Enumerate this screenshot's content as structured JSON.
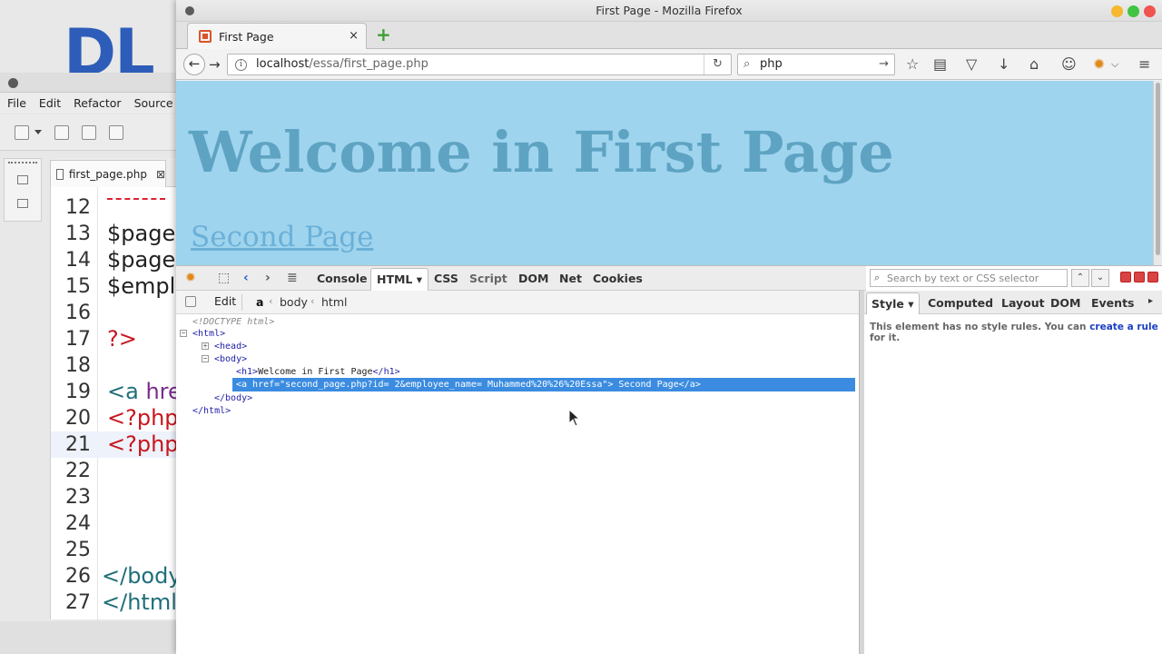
{
  "ide": {
    "logo_text": "DL",
    "menu": [
      "File",
      "Edit",
      "Refactor",
      "Source"
    ],
    "tab_label": "first_page.php",
    "tab_close": "⊠",
    "lines": [
      {
        "n": "12",
        "code": ""
      },
      {
        "n": "13",
        "code": "$page"
      },
      {
        "n": "14",
        "code": "$page"
      },
      {
        "n": "15",
        "code": "$empl"
      },
      {
        "n": "16",
        "code": ""
      },
      {
        "n": "17",
        "code": "?>"
      },
      {
        "n": "18",
        "code": ""
      },
      {
        "n": "19",
        "code_a": "<a",
        "code_b": " hre"
      },
      {
        "n": "20",
        "code": "<?php"
      },
      {
        "n": "21",
        "code": "<?php"
      },
      {
        "n": "22",
        "code": ""
      },
      {
        "n": "23",
        "code": ""
      },
      {
        "n": "24",
        "code": ""
      },
      {
        "n": "25",
        "code": ""
      },
      {
        "n": "26",
        "code": "</body"
      },
      {
        "n": "27",
        "code": "</html"
      }
    ]
  },
  "firefox": {
    "window_title": "First Page - Mozilla Firefox",
    "tab_title": "First Page",
    "tab_close": "×",
    "new_tab": "+",
    "url_host": "localhost",
    "url_path": "/essa/first_page.php",
    "search_value": "php",
    "icons": [
      "star-icon",
      "reading-list-icon",
      "pocket-icon",
      "download-icon",
      "home-icon",
      "chat-icon",
      "firebug-icon",
      "menu-icon"
    ],
    "colors": {
      "page_bg": "#9fd4ee",
      "heading": "#5ea3c2",
      "link": "#6bb0d7",
      "selection": "#3b8ce0"
    }
  },
  "page": {
    "heading": "Welcome in First Page",
    "link": "Second Page"
  },
  "firebug": {
    "tabs": [
      "Console",
      "HTML",
      "CSS",
      "Script",
      "DOM",
      "Net",
      "Cookies"
    ],
    "active_tab": "HTML",
    "edit_label": "Edit",
    "breadcrumb": [
      "a",
      "body",
      "html"
    ],
    "search_placeholder": "Search by text or CSS selector",
    "tree": {
      "doctype": "<!DOCTYPE html>",
      "html_open": "<html>",
      "head": "<head>",
      "body_open": "<body>",
      "h1_open": "<h1>",
      "h1_text": "Welcome in First Page",
      "h1_close": "</h1>",
      "selected": "<a href=\"second_page.php?id= 2&employee_name= Muhammed%20%26%20Essa\"> Second Page</a>",
      "body_close": "</body>",
      "html_close": "</html>"
    },
    "side_tabs": [
      "Style",
      "Computed",
      "Layout",
      "DOM",
      "Events"
    ],
    "side_msg_a": "This element has no style rules. You can ",
    "side_msg_link": "create a rule",
    "side_msg_b": " for it."
  }
}
